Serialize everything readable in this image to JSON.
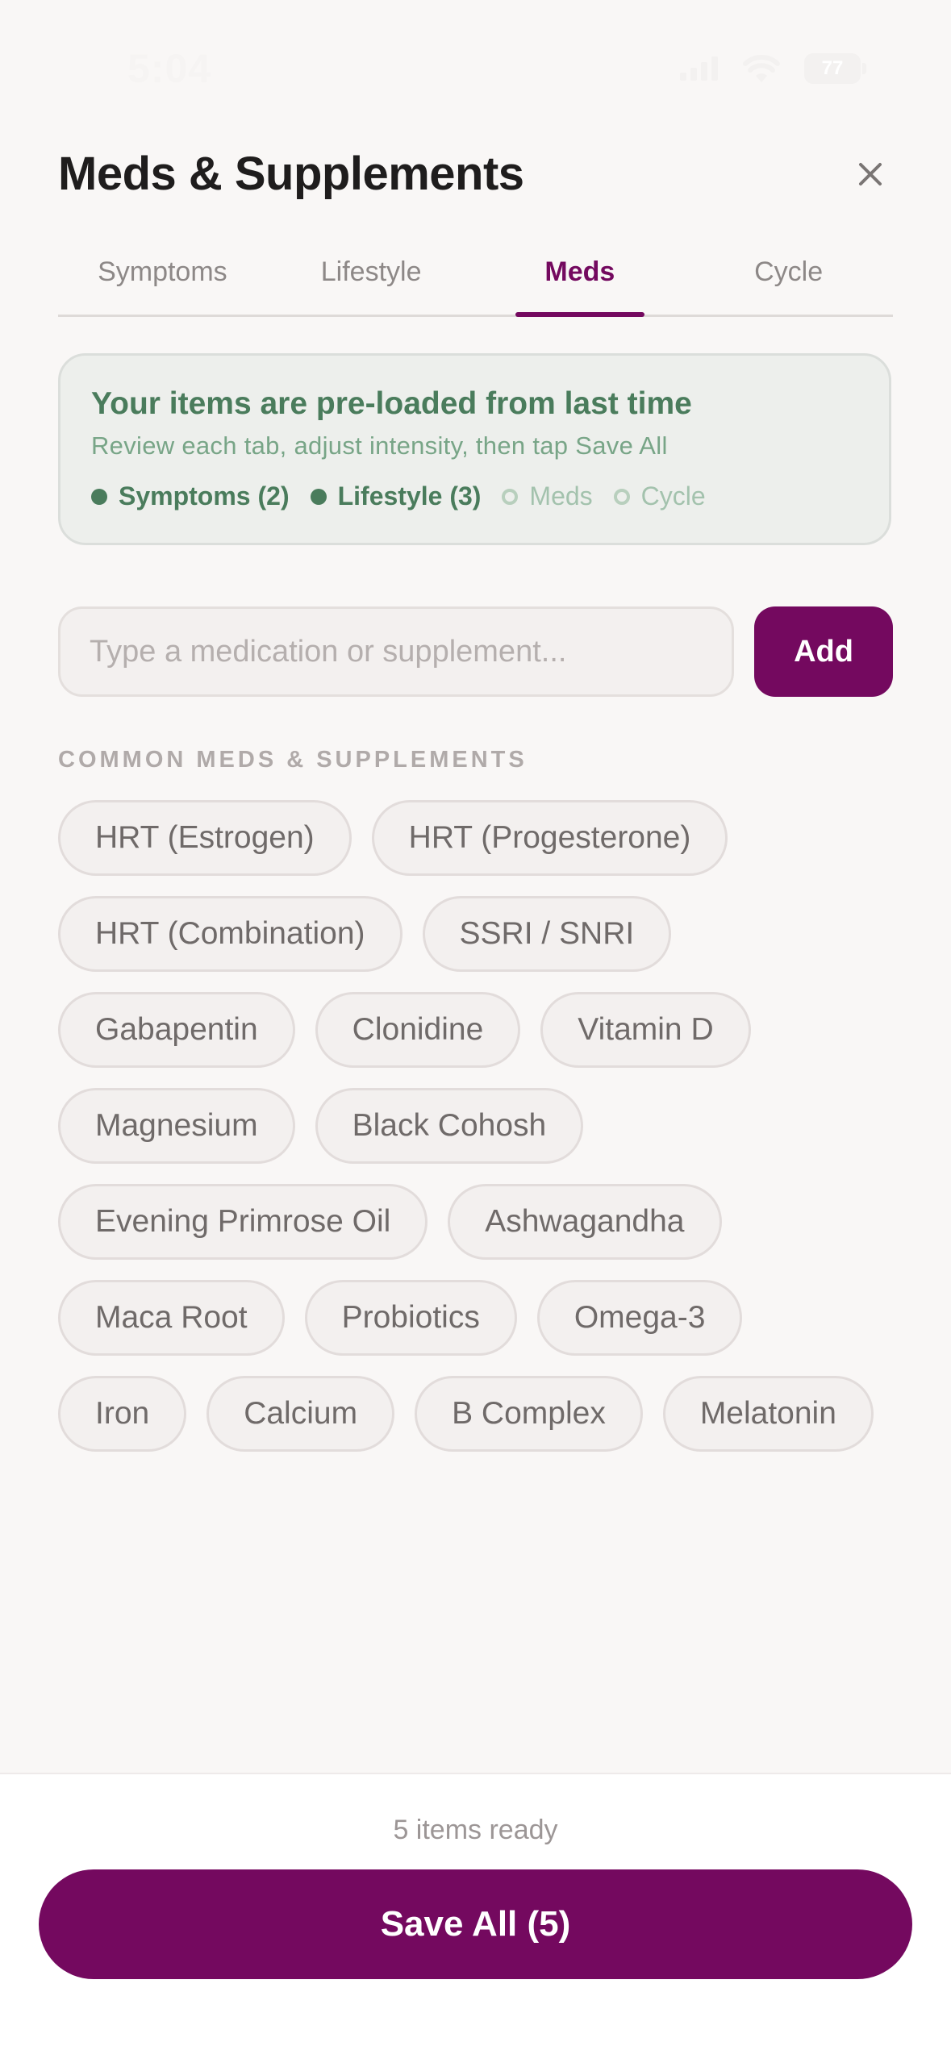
{
  "status_bar": {
    "time": "5:04",
    "battery": "77",
    "icons": [
      "signal-icon",
      "wifi-icon",
      "battery-icon"
    ]
  },
  "header": {
    "title": "Meds & Supplements",
    "close_icon": "close-icon"
  },
  "tabs": [
    {
      "label": "Symptoms",
      "active": false
    },
    {
      "label": "Lifestyle",
      "active": false
    },
    {
      "label": "Meds",
      "active": true
    },
    {
      "label": "Cycle",
      "active": false
    }
  ],
  "info_card": {
    "title": "Your items are pre-loaded from last time",
    "subtitle": "Review each tab, adjust intensity, then tap Save All",
    "progress": [
      {
        "label": "Symptoms (2)",
        "done": true
      },
      {
        "label": "Lifestyle (3)",
        "done": true
      },
      {
        "label": "Meds",
        "done": false
      },
      {
        "label": "Cycle",
        "done": false
      }
    ]
  },
  "search": {
    "placeholder": "Type a medication or supplement...",
    "value": "",
    "add_label": "Add"
  },
  "common": {
    "section_label": "COMMON MEDS & SUPPLEMENTS",
    "rows": [
      [
        "HRT (Estrogen)",
        "HRT (Progesterone)"
      ],
      [
        "HRT (Combination)",
        "SSRI / SNRI"
      ],
      [
        "Gabapentin",
        "Clonidine",
        "Vitamin D"
      ],
      [
        "Magnesium",
        "Black Cohosh"
      ],
      [
        "Evening Primrose Oil",
        "Ashwagandha"
      ],
      [
        "Maca Root",
        "Probiotics",
        "Omega-3"
      ],
      [
        "Iron",
        "Calcium",
        "B Complex",
        "Melatonin"
      ]
    ]
  },
  "footer": {
    "items_ready": "5 items ready",
    "save_label": "Save All (5)"
  },
  "colors": {
    "accent": "#74095f",
    "success": "#4a7c5c",
    "background": "#f9f7f6",
    "card": "#edefec"
  }
}
